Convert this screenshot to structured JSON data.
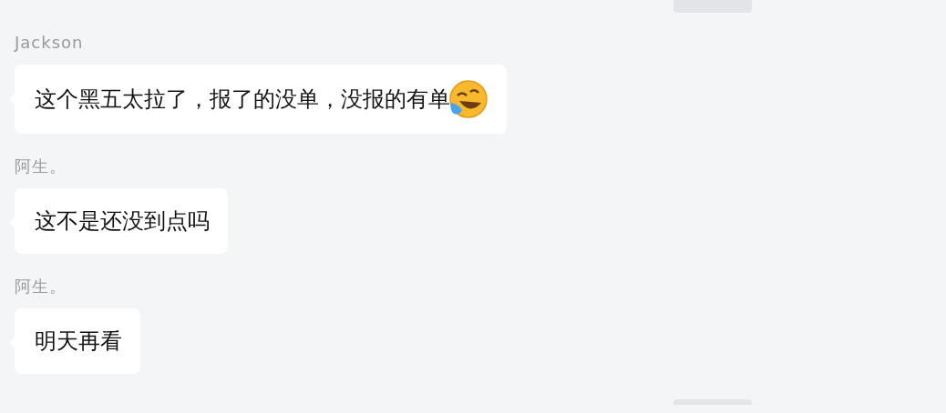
{
  "messages": [
    {
      "sender": "Jackson",
      "text": "这个黑五太拉了，报了的没单，没报的有单",
      "kind": "emoji"
    },
    {
      "sender": "阿生。",
      "text": "这不是还没到点吗",
      "kind": "text"
    },
    {
      "sender": "阿生。",
      "text": "明天再看",
      "kind": "text"
    }
  ]
}
